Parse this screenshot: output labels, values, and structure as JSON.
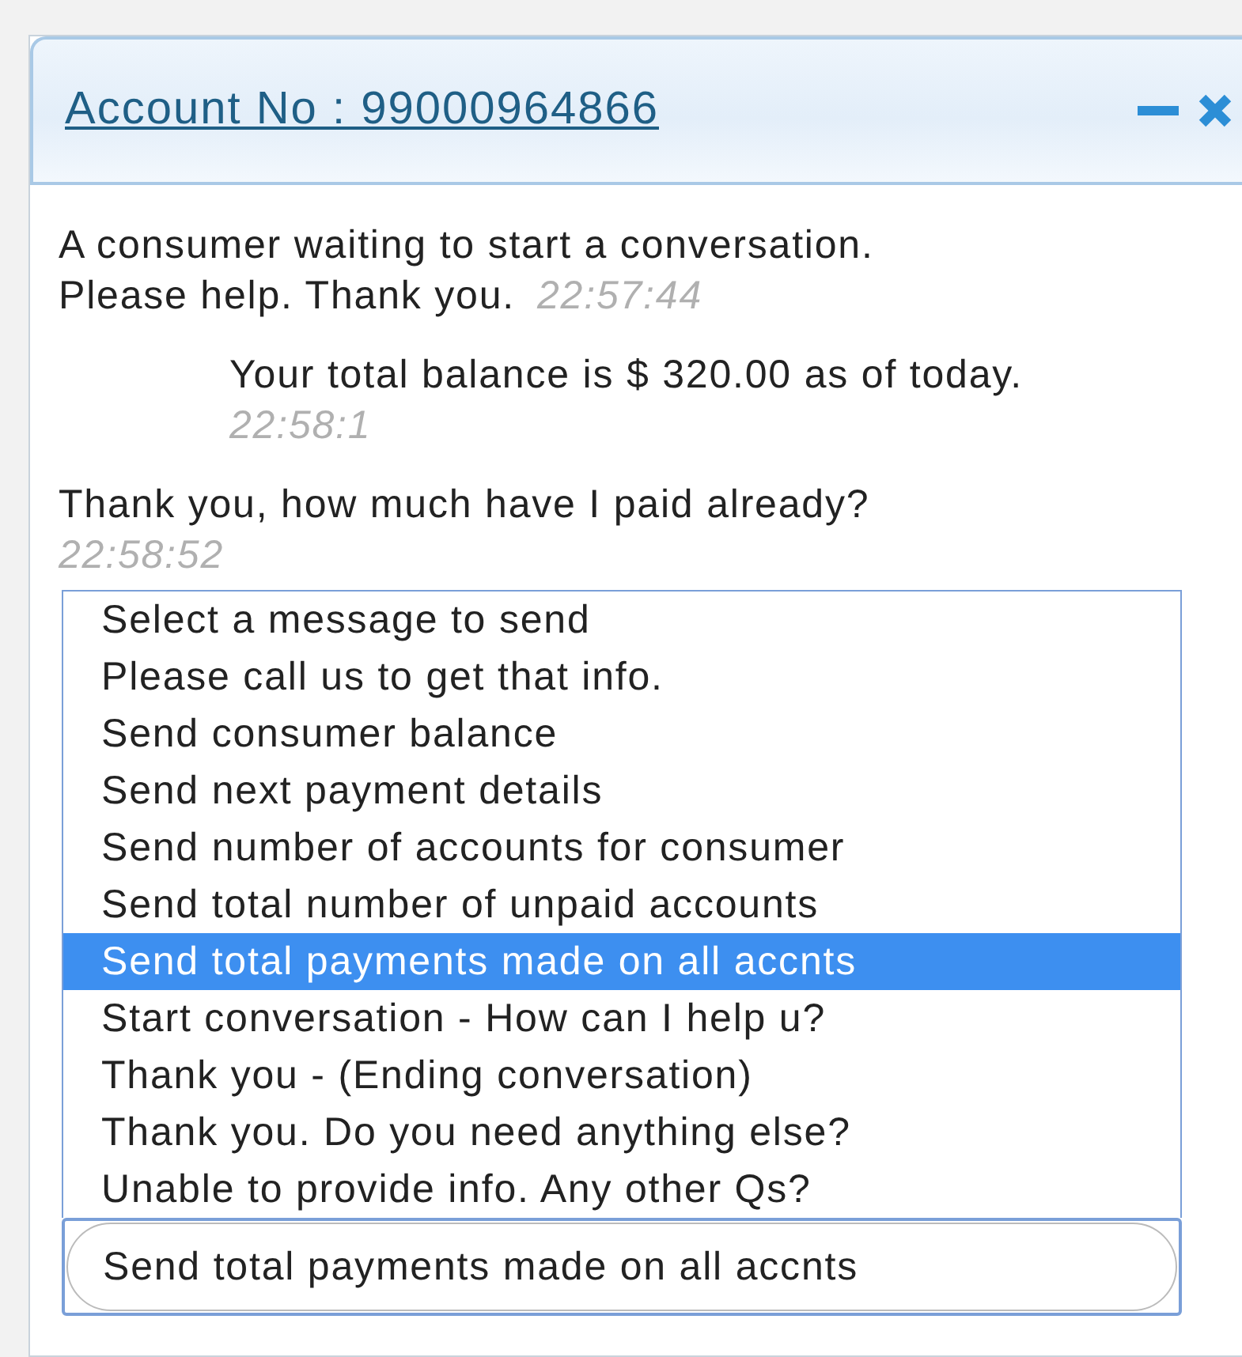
{
  "window": {
    "title": "Account No : 99000964866"
  },
  "messages": [
    {
      "kind": "system",
      "lines": [
        "A consumer waiting to start a conversation.",
        "Please help. Thank you."
      ],
      "time": "22:57:44"
    },
    {
      "kind": "outgoing",
      "lines": [
        "Your total balance is $ 320.00 as of today."
      ],
      "time": "22:58:1"
    },
    {
      "kind": "incoming",
      "lines": [
        "Thank you, how much have I paid already?"
      ],
      "time": "22:58:52"
    }
  ],
  "message_list": {
    "options": [
      {
        "label": "Select a message to send",
        "selected": false
      },
      {
        "label": "Please call us to get that info.",
        "selected": false
      },
      {
        "label": "Send consumer balance",
        "selected": false
      },
      {
        "label": "Send next payment details",
        "selected": false
      },
      {
        "label": "Send number of accounts for consumer",
        "selected": false
      },
      {
        "label": "Send total number of unpaid accounts",
        "selected": false
      },
      {
        "label": "Send total payments made on all accnts",
        "selected": true
      },
      {
        "label": "Start conversation - How can I help u?",
        "selected": false
      },
      {
        "label": "Thank you - (Ending conversation)",
        "selected": false
      },
      {
        "label": "Thank you. Do you need anything else?",
        "selected": false
      },
      {
        "label": "Unable to provide info. Any other Qs?",
        "selected": false
      }
    ]
  },
  "message_field": {
    "value": "Send total payments made on all accnts"
  }
}
